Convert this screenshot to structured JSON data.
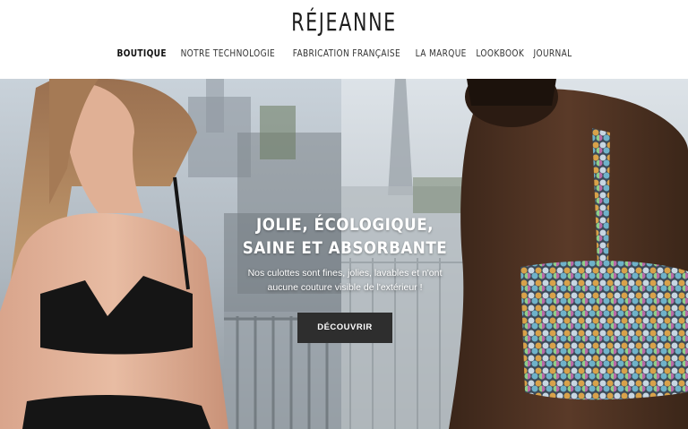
{
  "brand": {
    "logo": "RÉJEANNE"
  },
  "nav": {
    "items": [
      {
        "label": "BOUTIQUE",
        "active": true
      },
      {
        "label": "NOTRE TECHNOLOGIE"
      },
      {
        "label": "FABRICATION FRANÇAISE"
      },
      {
        "label": "LA MARQUE"
      },
      {
        "label": "LOOKBOOK"
      },
      {
        "label": "JOURNAL"
      }
    ]
  },
  "hero": {
    "title_line1": "JOLIE, ÉCOLOGIQUE,",
    "title_line2": "SAINE ET ABSORBANTE",
    "subtitle_line1": "Nos culottes sont fines, jolies, lavables et n'ont",
    "subtitle_line2": "aucune couture visible de l'extérieur !",
    "cta_label": "DÉCOUVRIR"
  },
  "colors": {
    "cta_background": "#2e2e2e",
    "text": "#1d1d1d"
  }
}
